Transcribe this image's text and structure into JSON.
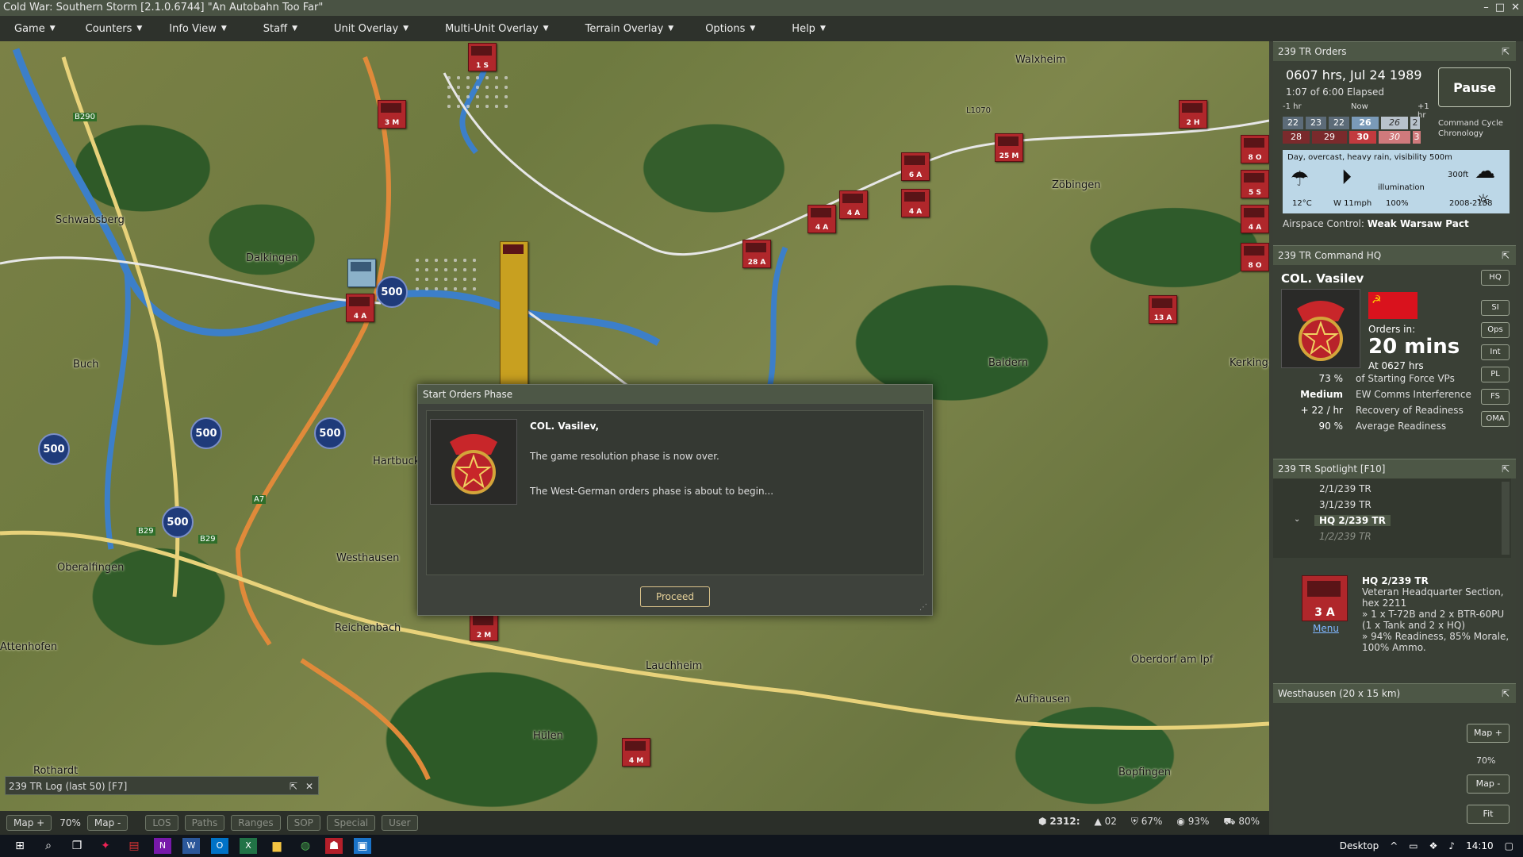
{
  "window": {
    "title": "Cold War: Southern Storm  [2.1.0.6744]  \"An Autobahn Too Far\"",
    "controls": [
      "–",
      "□",
      "✕"
    ]
  },
  "menu": [
    "Game",
    "Counters",
    "Info View",
    "Staff",
    "Unit Overlay",
    "Multi-Unit Overlay",
    "Terrain Overlay",
    "Options",
    "Help"
  ],
  "map": {
    "places": [
      "Schwabsberg",
      "Dalkingen",
      "Buch",
      "Oberalfingen",
      "Westhausen",
      "Hartbuck",
      "Reichenbach",
      "Lauchheim",
      "Hülen",
      "Aufhausen",
      "Oberdorf am Ipf",
      "Bopfingen",
      "Zöbingen",
      "Baldern",
      "Walxheim",
      "Kerkingen",
      "Attenhofen",
      "Rothardt"
    ],
    "road_labels": [
      "B290",
      "A7",
      "B29",
      "B29",
      "L1070"
    ],
    "hex_500": [
      "500",
      "500",
      "500",
      "500",
      "500"
    ],
    "counters": [
      "1 S",
      "3 M",
      "4 A",
      "28 A",
      "4 A",
      "4 A",
      "4 A",
      "6 A",
      "25 M",
      "13 A",
      "2 H",
      "8 O",
      "5 S",
      "4 A",
      "8 O",
      "2 M",
      "4 M"
    ]
  },
  "log": {
    "title": "239 TR Log (last 50)   [F7]",
    "pin": "⇱",
    "close": "✕"
  },
  "status": {
    "buttons": [
      "Map +",
      "Map -"
    ],
    "zoom": "70%",
    "disabled_buttons": [
      "LOS",
      "Paths",
      "Ranges",
      "SOP",
      "Special",
      "User"
    ],
    "hex": "2312:",
    "elev": "02",
    "cover": "67%",
    "vis": "93%",
    "move": "80%"
  },
  "dialog": {
    "title": "Start Orders Phase",
    "greeting": "COL. Vasilev,",
    "line1": "The game resolution phase is now over.",
    "line2": "The West-German orders phase is about to begin...",
    "proceed": "Proceed"
  },
  "orders_panel": {
    "title": "239 TR Orders",
    "time": "0607 hrs, Jul 24 1989",
    "elapsed": "1:07 of 6:00 Elapsed",
    "pause": "Pause",
    "chrono_minus": "-1 hr",
    "chrono_now": "Now",
    "chrono_plus": "+1 hr",
    "row1": [
      "22",
      "23",
      "22",
      "26",
      "26",
      "2"
    ],
    "row2": [
      "28",
      "29",
      "30",
      "30",
      "3"
    ],
    "command_cycle": "Command Cycle Chronology",
    "weather_text": "Day, overcast, heavy rain, visibility 500m",
    "illumination": "illumination",
    "ceiling": "300ft",
    "temp": "12°C",
    "wind": "W 11mph",
    "visibility": "100%",
    "hours": "2008-2138",
    "airspace_label": "Airspace Control:",
    "airspace_value": "Weak Warsaw Pact"
  },
  "hq_panel": {
    "title": "239 TR Command HQ",
    "commander": "COL. Vasilev",
    "flag_symbol": "☭",
    "orders_in": "Orders in:",
    "orders_mins": "20 mins",
    "orders_at": "At 0627 hrs",
    "buttons": [
      "HQ",
      "SI",
      "Ops",
      "Int",
      "PL",
      "FS",
      "OMA"
    ],
    "stats": [
      {
        "v": "73 %",
        "d": "of Starting Force VPs"
      },
      {
        "v": "Medium",
        "d": "EW Comms Interference"
      },
      {
        "v": "+ 22 / hr",
        "d": "Recovery of Readiness"
      },
      {
        "v": "90 %",
        "d": "Average Readiness"
      }
    ]
  },
  "spotlight": {
    "title": "239 TR Spotlight   [F10]",
    "items": [
      "2/1/239 TR",
      "3/1/239 TR",
      "HQ 2/239 TR",
      "1/2/239 TR"
    ],
    "unit_counter": "3 A",
    "unit_menu": "Menu",
    "unit_name": "HQ 2/239 TR",
    "unit_desc": "Veteran Headquarter Section, hex 2211",
    "unit_line1": "» 1 x T-72B and 2 x BTR-60PU (1 x Tank and 2 x HQ)",
    "unit_line2": "» 94% Readiness, 85% Morale, 100% Ammo."
  },
  "minimap": {
    "title": "Westhausen (20 x 15 km)",
    "map_plus": "Map +",
    "zoom": "70%",
    "map_minus": "Map -",
    "fit": "Fit"
  },
  "taskbar": {
    "desktop": "Desktop",
    "clock": "14:10"
  }
}
